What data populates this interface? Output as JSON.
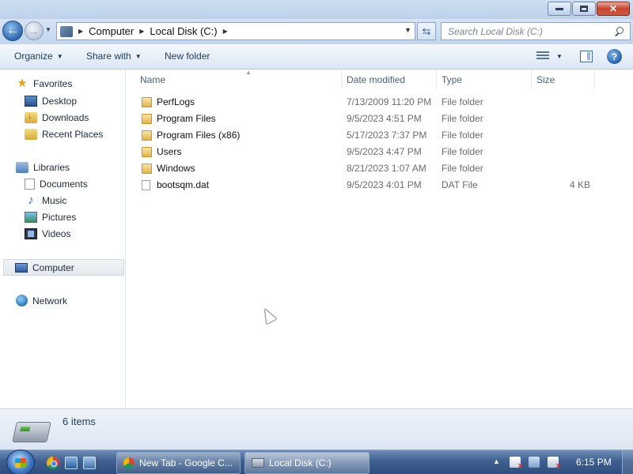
{
  "window": {
    "title": "Local Disk (C:)"
  },
  "address_bar": {
    "crumbs": [
      "Computer",
      "Local Disk (C:)"
    ],
    "search_placeholder": "Search Local Disk (C:)"
  },
  "command_bar": {
    "organize": "Organize",
    "share_with": "Share with",
    "new_folder": "New folder"
  },
  "nav_pane": {
    "favorites": {
      "label": "Favorites",
      "items": [
        "Desktop",
        "Downloads",
        "Recent Places"
      ]
    },
    "libraries": {
      "label": "Libraries",
      "items": [
        "Documents",
        "Music",
        "Pictures",
        "Videos"
      ]
    },
    "computer": "Computer",
    "network": "Network"
  },
  "columns": {
    "name": "Name",
    "date_modified": "Date modified",
    "type": "Type",
    "size": "Size"
  },
  "files": [
    {
      "name": "PerfLogs",
      "date": "7/13/2009 11:20 PM",
      "type": "File folder",
      "size": "",
      "icon": "folder-icon"
    },
    {
      "name": "Program Files",
      "date": "9/5/2023 4:51 PM",
      "type": "File folder",
      "size": "",
      "icon": "folder-icon"
    },
    {
      "name": "Program Files (x86)",
      "date": "5/17/2023 7:37 PM",
      "type": "File folder",
      "size": "",
      "icon": "folder-icon"
    },
    {
      "name": "Users",
      "date": "9/5/2023 4:47 PM",
      "type": "File folder",
      "size": "",
      "icon": "folder-icon"
    },
    {
      "name": "Windows",
      "date": "8/21/2023 1:07 AM",
      "type": "File folder",
      "size": "",
      "icon": "folder-icon"
    },
    {
      "name": "bootsqm.dat",
      "date": "9/5/2023 4:01 PM",
      "type": "DAT File",
      "size": "4 KB",
      "icon": "file-icon"
    }
  ],
  "details_pane": {
    "item_count": "6 items"
  },
  "taskbar": {
    "tasks": [
      {
        "label": "New Tab - Google C...",
        "icon": "chrome-icon",
        "active": false
      },
      {
        "label": "Local Disk (C:)",
        "icon": "drive-icon",
        "active": true
      }
    ],
    "clock": "6:15 PM"
  }
}
